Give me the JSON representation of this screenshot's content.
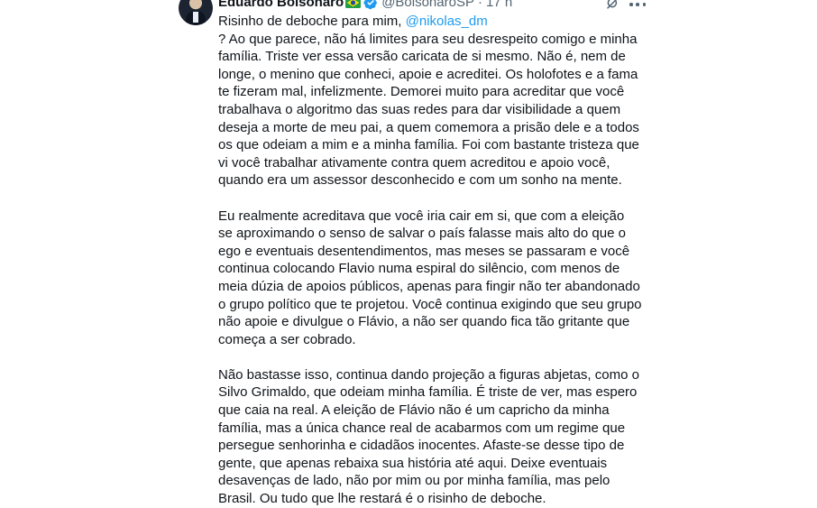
{
  "author": {
    "name": "Eduardo Bolsonaro",
    "handle": "@BolsonaroSP",
    "separator": "·",
    "time": "17 h",
    "flag_icon": "brazil-flag-icon",
    "verified_icon": "verified-badge-icon",
    "verified_color": "#1d9bf0"
  },
  "actions": {
    "grok_icon": "grok-icon",
    "more_icon": "more-options-icon"
  },
  "tweet": {
    "line1_text": "Risinho de deboche para mim, ",
    "mention": "@nikolas_dm",
    "paragraph1": "? Ao que parece, não há limites para seu desrespeito comigo e minha família. Triste ver essa versão caricata de si mesmo. Não é, nem de longe, o menino que conheci, apoie e acreditei. Os holofotes e a fama te fizeram mal, infelizmente. Demorei muito para acreditar que você trabalhava o algoritmo das suas redes para dar visibilidade a quem deseja a morte de meu pai, a quem comemora a prisão dele e a todos os que odeiam a mim e a minha família. Foi com bastante tristeza que vi você trabalhar ativamente contra quem acreditou e apoio você, quando era um assessor desconhecido e com um sonho na mente.",
    "paragraph2": "Eu realmente acreditava que você iria cair em si, que com a eleição se aproximando o senso de salvar o país falasse mais alto do que o ego e eventuais desentendimentos, mas meses se passaram e você continua colocando Flavio numa espiral do silêncio, com menos de meia dúzia de apoios públicos, apenas para fingir não ter abandonado o grupo político que te projetou. Você continua exigindo que seu grupo não apoie e divulgue o Flávio, a não ser quando fica tão gritante que começa a ser cobrado.",
    "paragraph3": "Não bastasse isso, continua dando projeção a figuras abjetas, como o Silvo Grimaldo, que odeiam minha família. É triste de ver, mas espero que caia na real. A eleição de Flávio não é um capricho da minha família, mas a única chance real de acabarmos com um regime que persegue senhorinha e cidadãos inocentes. Afaste-se desse tipo de gente, que apenas rebaixa sua história até aqui. Deixe eventuais desavenças de lado, não por mim ou por minha família, mas pelo Brasil. Ou tudo que lhe restará é o risinho de deboche."
  },
  "colors": {
    "text": "#0f1419",
    "secondary": "#536471",
    "link": "#1d9bf0"
  }
}
